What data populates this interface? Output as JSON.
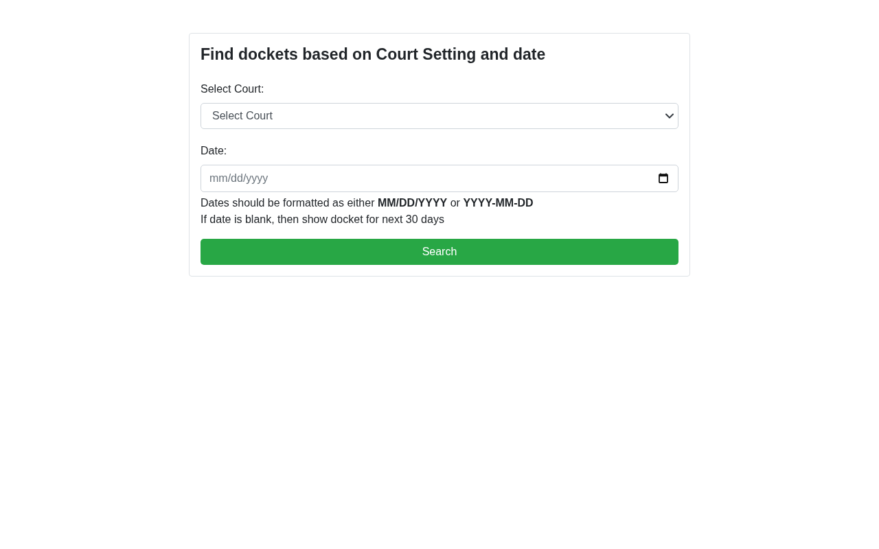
{
  "card": {
    "title": "Find dockets based on Court Setting and date",
    "fields": [
      {
        "kind": "select",
        "label": "Select Court:",
        "value": "Select Court"
      },
      {
        "kind": "date",
        "label": "Date:",
        "placeholder": "mm/dd/yyyy"
      }
    ],
    "hints": [
      "Dates should be formatted as either **MM/DD/YYYY** or **YYYY-MM-DD**",
      "If date is blank, then show docket for next 30 days"
    ],
    "search_button": "Search"
  }
}
